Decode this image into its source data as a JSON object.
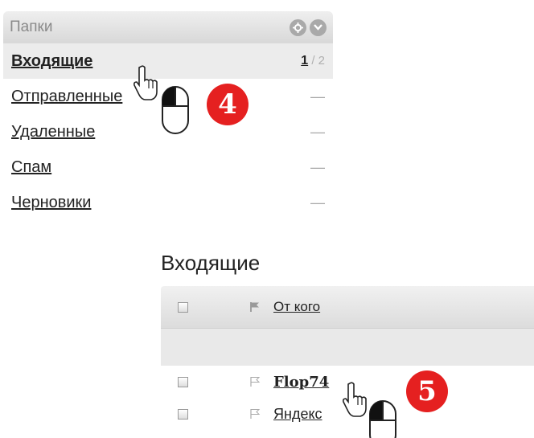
{
  "folders": {
    "title": "Папки",
    "items": [
      {
        "label": "Входящие",
        "unread": "1",
        "total": "/ 2"
      },
      {
        "label": "Отправленные",
        "count": "—"
      },
      {
        "label": "Удаленные",
        "count": "—"
      },
      {
        "label": "Спам",
        "count": "—"
      },
      {
        "label": "Черновики",
        "count": "—"
      }
    ]
  },
  "steps": {
    "first": "4",
    "second": "5"
  },
  "inbox": {
    "title": "Входящие",
    "column_from": "От кого",
    "messages": [
      {
        "sender": "Flop74",
        "unread": true
      },
      {
        "sender": "Яндекс",
        "unread": false
      }
    ]
  },
  "colors": {
    "badge": "#e52020",
    "panel_header": "#d8d8d8"
  },
  "icons": [
    "gear-icon",
    "chevron-down-icon",
    "flag-icon",
    "hand-pointer-icon",
    "mouse-icon"
  ]
}
